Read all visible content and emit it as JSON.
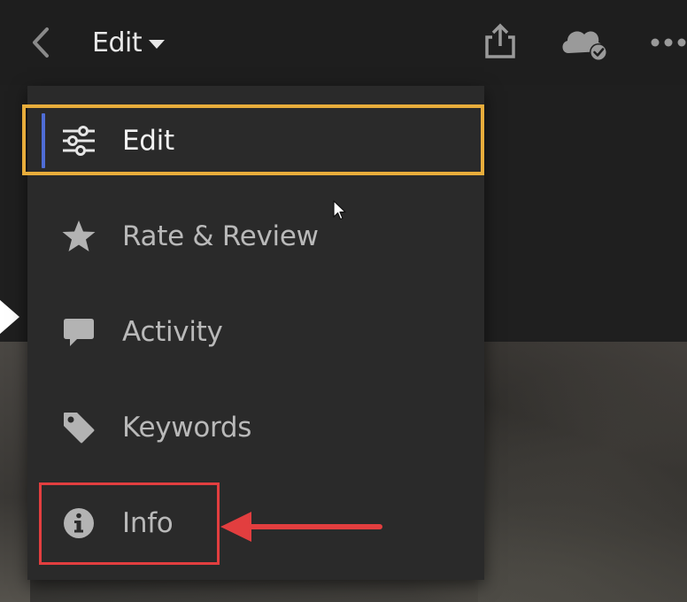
{
  "header": {
    "back_icon": "chevron-left-icon",
    "mode_label": "Edit",
    "mode_caret_icon": "caret-down-icon",
    "share_icon": "share-upload-icon",
    "cloud_icon": "cloud-synced-icon",
    "more_icon": "more-horizontal-icon"
  },
  "menu": {
    "items": [
      {
        "label": "Edit",
        "icon": "sliders-icon",
        "active": true
      },
      {
        "label": "Rate & Review",
        "icon": "star-icon",
        "active": false
      },
      {
        "label": "Activity",
        "icon": "speech-bubble-icon",
        "active": false
      },
      {
        "label": "Keywords",
        "icon": "tag-icon",
        "active": false
      },
      {
        "label": "Info",
        "icon": "info-icon",
        "active": false
      }
    ]
  },
  "annotations": {
    "yellow_box_color": "#e8ad3b",
    "red_box_color": "#e23e3f",
    "arrow_color": "#e23e3f",
    "active_indicator_color": "#4f6dd6"
  }
}
